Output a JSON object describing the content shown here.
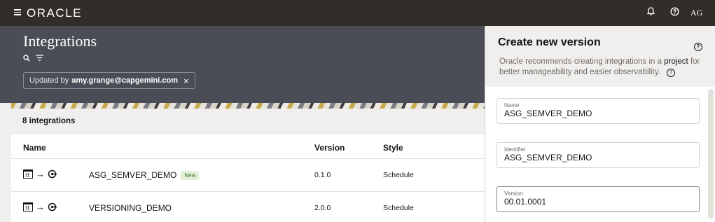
{
  "topbar": {
    "logo": "ORACLE",
    "initials": "AG",
    "icons": [
      "menu-icon",
      "bell-icon",
      "help-icon"
    ]
  },
  "header": {
    "title": "Integrations",
    "filter_chip": {
      "prefix": "Updated by",
      "value": "amy.grange@capgemini.com",
      "close": "×"
    }
  },
  "main": {
    "count_label": "8 integrations",
    "columns": [
      "Name",
      "Version",
      "Style"
    ],
    "rows": [
      {
        "name": "ASG_SEMVER_DEMO",
        "badge": "New",
        "version": "0.1.0",
        "style": "Schedule"
      },
      {
        "name": "VERSIONING_DEMO",
        "badge": "",
        "version": "2.0.0",
        "style": "Schedule"
      }
    ]
  },
  "drawer": {
    "title": "Create new version",
    "desc_before": "Oracle recommends creating integrations in a ",
    "desc_link": "project",
    "desc_after": " for better manageability and easier observability.",
    "fields": {
      "name": {
        "label": "Name",
        "value": "ASG_SEMVER_DEMO"
      },
      "identifier": {
        "label": "Identifier",
        "value": "ASG_SEMVER_DEMO"
      },
      "version": {
        "label": "Version",
        "value": "00.01.0001"
      }
    }
  }
}
